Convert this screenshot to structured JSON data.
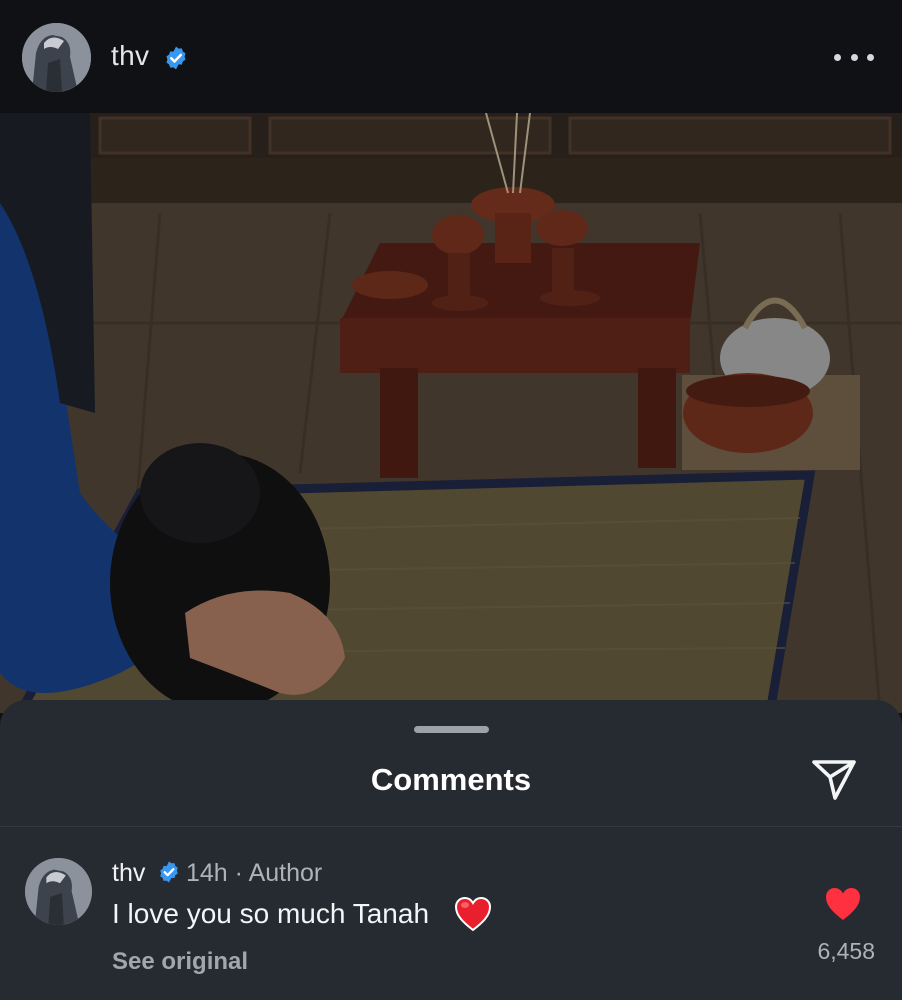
{
  "header": {
    "username": "thv",
    "verified_icon": "verified-badge-icon",
    "more_icon": "more-horizontal-icon"
  },
  "media": {
    "description_icon": "video-frame"
  },
  "comments_sheet": {
    "title": "Comments",
    "share_icon": "send-icon",
    "comments": [
      {
        "username": "thv",
        "time": "14h",
        "separator": "·",
        "role": "Author",
        "text": "I love you so much Tanah",
        "emoji": "red-heart-emoji",
        "see_original_label": "See original",
        "like_count": "6,458",
        "liked": true
      }
    ]
  },
  "colors": {
    "background": "#0f1115",
    "sheet": "#262a31",
    "verified_blue": "#3897f0",
    "like_red": "#ff3040",
    "muted_text": "#aeb2b9"
  }
}
